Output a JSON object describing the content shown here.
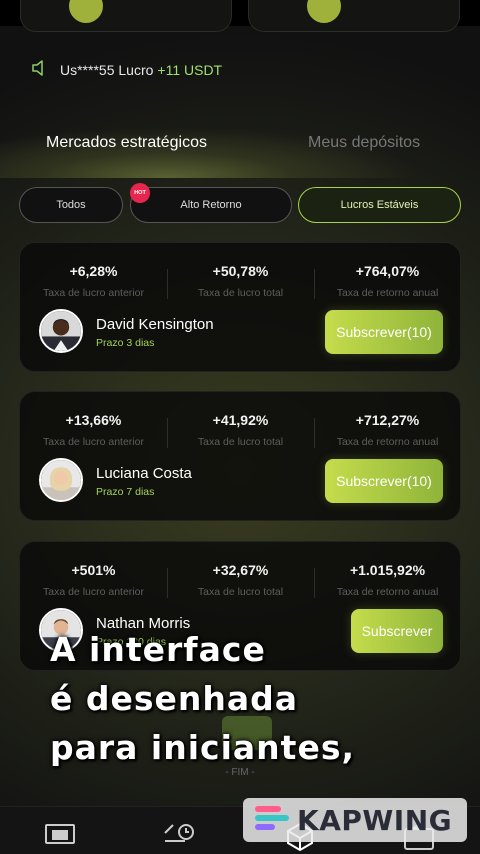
{
  "notice": {
    "user": "Us****55 Lucro",
    "amount": "+11 USDT"
  },
  "tabs": {
    "active": "Mercados estratégicos",
    "inactive": "Meus depósitos"
  },
  "filters": {
    "all": "Todos",
    "high": "Alto Retorno",
    "hot_badge": "HOT",
    "stable": "Lucros Estáveis"
  },
  "labels": {
    "prev_rate": "Taxa de lucro anterior",
    "total_rate": "Taxa de lucro total",
    "annual": "Taxa de retorno anual"
  },
  "traders": [
    {
      "prev": "+6,28%",
      "total": "+50,78%",
      "annual": "+764,07%",
      "name": "David Kensington",
      "term": "Prazo 3 dias",
      "button": "Subscrever(10)"
    },
    {
      "prev": "+13,66%",
      "total": "+41,92%",
      "annual": "+712,27%",
      "name": "Luciana Costa",
      "term": "Prazo 7 dias",
      "button": "Subscrever(10)"
    },
    {
      "prev": "+501%",
      "total": "+32,67%",
      "annual": "+1.015,92%",
      "name": "Nathan Morris",
      "term": "Prazo 180 dias",
      "button": "Subscrever"
    }
  ],
  "end_label": "- FIM -",
  "caption": {
    "line1": "A interface",
    "line2": "é desenhada",
    "line3": "para iniciantes,"
  },
  "watermark": "KAPWING",
  "colors": {
    "accent": "#b7d84a",
    "profit": "#9fe26b",
    "hot": "#e7264f"
  },
  "icons": [
    "speaker-icon",
    "monitor-icon",
    "exchange-icon",
    "cube-icon",
    "wallet-icon"
  ]
}
